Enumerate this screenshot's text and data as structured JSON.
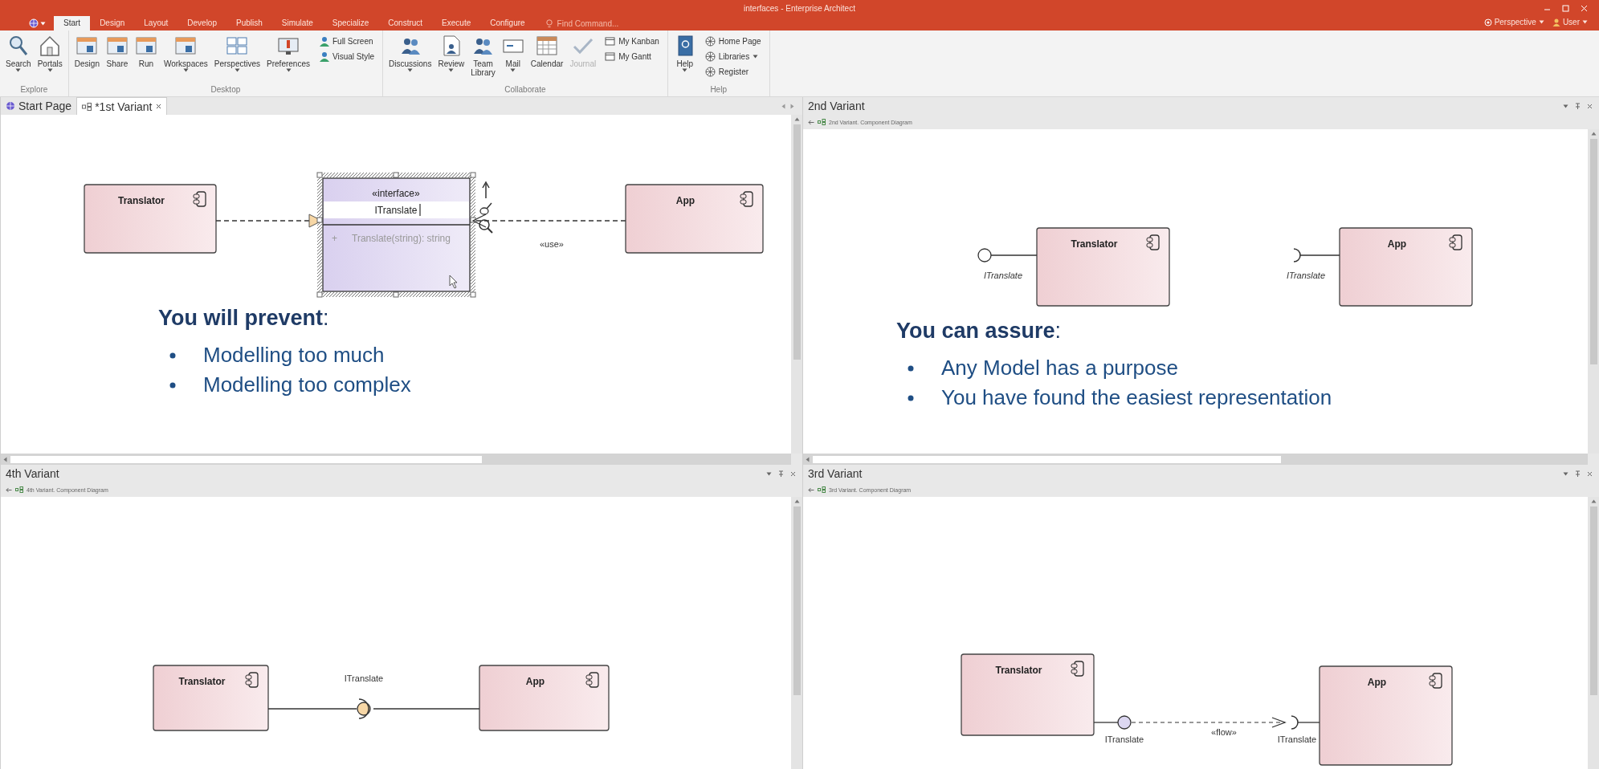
{
  "window": {
    "title": "interfaces - Enterprise Architect"
  },
  "title_actions": [
    {
      "label": "Perspective",
      "dropdown": true
    },
    {
      "label": "User",
      "dropdown": true
    }
  ],
  "ribbon_tabs": [
    {
      "label": "Start",
      "selected": true
    },
    {
      "label": "Design",
      "selected": false
    },
    {
      "label": "Layout",
      "selected": false
    },
    {
      "label": "Develop",
      "selected": false
    },
    {
      "label": "Publish",
      "selected": false
    },
    {
      "label": "Simulate",
      "selected": false
    },
    {
      "label": "Specialize",
      "selected": false
    },
    {
      "label": "Construct",
      "selected": false
    },
    {
      "label": "Execute",
      "selected": false
    },
    {
      "label": "Configure",
      "selected": false
    }
  ],
  "find_command": {
    "placeholder": "Find Command..."
  },
  "ribbon_groups": [
    {
      "label": "Explore",
      "items": [
        {
          "label": "Search",
          "kind": "large",
          "dropdown": true,
          "disabled": false
        },
        {
          "label": "Portals",
          "kind": "large",
          "dropdown": true,
          "disabled": false
        }
      ]
    },
    {
      "label": "Desktop",
      "items": [
        {
          "label": "Design",
          "kind": "large",
          "dropdown": false,
          "disabled": false
        },
        {
          "label": "Share",
          "kind": "large",
          "dropdown": false,
          "disabled": false
        },
        {
          "label": "Run",
          "kind": "large",
          "dropdown": false,
          "disabled": false
        },
        {
          "label": "Workspaces",
          "kind": "large",
          "dropdown": true,
          "disabled": false
        },
        {
          "label": "Perspectives",
          "kind": "large",
          "dropdown": true,
          "disabled": false
        },
        {
          "label": "Preferences",
          "kind": "large",
          "dropdown": true,
          "disabled": false
        },
        {
          "label": "Full Screen",
          "kind": "small",
          "dropdown": false,
          "disabled": false
        },
        {
          "label": "Visual Style",
          "kind": "small",
          "dropdown": false,
          "disabled": false
        }
      ]
    },
    {
      "label": "Collaborate",
      "items": [
        {
          "label": "Discussions",
          "kind": "large",
          "dropdown": true,
          "disabled": false
        },
        {
          "label": "Review",
          "kind": "large",
          "dropdown": true,
          "disabled": false
        },
        {
          "label": "Team Library",
          "kind": "large",
          "dropdown": false,
          "disabled": false
        },
        {
          "label": "Mail",
          "kind": "large",
          "dropdown": true,
          "disabled": false
        },
        {
          "label": "Calendar",
          "kind": "large",
          "dropdown": false,
          "disabled": false
        },
        {
          "label": "Journal",
          "kind": "large",
          "dropdown": false,
          "disabled": true
        },
        {
          "label": "My Kanban",
          "kind": "small",
          "dropdown": false,
          "disabled": false
        },
        {
          "label": "My Gantt",
          "kind": "small",
          "dropdown": false,
          "disabled": false
        }
      ]
    },
    {
      "label": "Help",
      "items": [
        {
          "label": "Help",
          "kind": "large",
          "dropdown": true,
          "disabled": false
        },
        {
          "label": "Home Page",
          "kind": "small",
          "dropdown": false,
          "disabled": false
        },
        {
          "label": "Libraries",
          "kind": "small",
          "dropdown": true,
          "disabled": false
        },
        {
          "label": "Register",
          "kind": "small",
          "dropdown": false,
          "disabled": false
        }
      ]
    }
  ],
  "doc_tabs": [
    {
      "label": "Start Page",
      "selected": false,
      "closable": false
    },
    {
      "label": "*1st Variant",
      "selected": true,
      "closable": true
    }
  ],
  "panels": [
    {
      "diagram": {
        "kind": "realization",
        "components": [
          "Translator",
          "App"
        ],
        "interface": {
          "stereotype": "«interface»",
          "name": "ITranslate",
          "visibility": "+",
          "operation": "Translate(string): string"
        },
        "connector_label": "«use»"
      },
      "note": {
        "heading": "**You will prevent**:",
        "bullets": [
          "Modelling too much",
          "Modelling too complex"
        ]
      }
    },
    {
      "title": "2nd Variant",
      "breadcrumb": "2nd Variant.  Component Diagram",
      "diagram": {
        "kind": "exposed",
        "components": [
          "Translator",
          "App"
        ],
        "provided_label": "ITranslate",
        "required_label": "ITranslate"
      },
      "note": {
        "heading": "**You can assure**:",
        "bullets": [
          "Any Model has a purpose",
          "You have found the easiest representation"
        ]
      }
    },
    {
      "title": "4th Variant",
      "breadcrumb": "4th Variant.  Component Diagram",
      "diagram": {
        "kind": "assembly",
        "components": [
          "Translator",
          "App"
        ],
        "interface_label": "ITranslate"
      }
    },
    {
      "title": "3rd Variant",
      "breadcrumb": "3rd Variant.  Component Diagram",
      "diagram": {
        "kind": "flow",
        "components": [
          "Translator",
          "App"
        ],
        "provided_label": "ITranslate",
        "required_label": "ITranslate",
        "connector_label": "«flow»"
      }
    }
  ]
}
